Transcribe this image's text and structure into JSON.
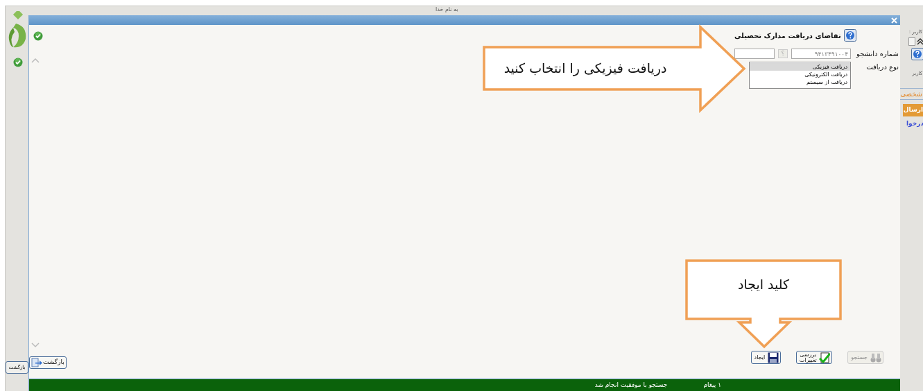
{
  "page_header": "به نام خدا",
  "background_page": {
    "user_label": "کاربر :",
    "user_label_2": "کاربر",
    "tab": "شخصی",
    "send_button": "ارسال",
    "request_link": "درخوا",
    "back_button": "بازگشت"
  },
  "dialog": {
    "title": "تقاضای دریافت مدارک تحصیلی",
    "student_field": {
      "label": "شماره دانشجو",
      "value": "۹۴۱۳۴۹۱۰۰۴",
      "lookup": "؟"
    },
    "delivery_field": {
      "label": "نوع دریافت",
      "options": [
        {
          "label": "دریافت فیزیکی",
          "selected": true
        },
        {
          "label": "دریافت الکترونیکی",
          "selected": false
        },
        {
          "label": "دریافت از سیستم",
          "selected": false
        }
      ]
    },
    "buttons": [
      {
        "kind": "search",
        "label": "جستجو",
        "disabled": true
      },
      {
        "kind": "review",
        "label": "بررسی تغییرات",
        "disabled": false
      },
      {
        "kind": "save",
        "label": "ایجاد",
        "disabled": false
      }
    ],
    "back_button": "بازگشت",
    "status_bar": {
      "count": "۱ پیغام",
      "message": "جستجو با موفقیت انجام شد"
    }
  },
  "callouts": [
    {
      "kind": "right",
      "text": "دریافت فیزیکی را انتخاب کنید"
    },
    {
      "kind": "down",
      "text": "کلید ایجاد"
    }
  ]
}
